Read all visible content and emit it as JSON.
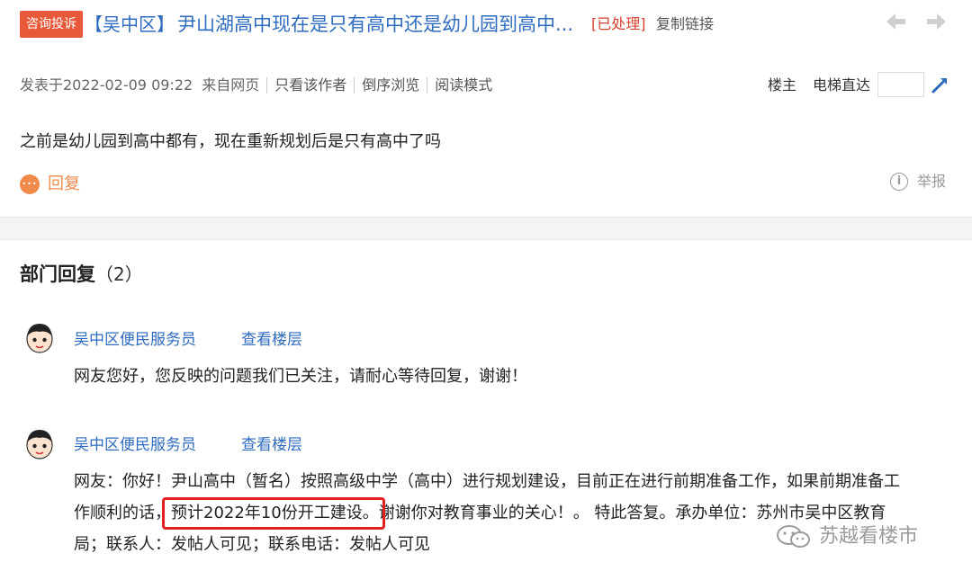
{
  "header": {
    "badge": "咨询投诉",
    "district": "【吴中区】",
    "title": "尹山湖高中现在是只有高中还是幼儿园到高中...",
    "status": "[已处理]",
    "copy_link": "复制链接"
  },
  "meta": {
    "posted": "发表于2022-02-09 09:22",
    "source": "来自网页",
    "only_author": "只看该作者",
    "reverse": "倒序浏览",
    "reading_mode": "阅读模式",
    "louzhu": "楼主",
    "elevator": "电梯直达",
    "floor_value": ""
  },
  "post": {
    "text": "之前是幼儿园到高中都有，现在重新规划后是只有高中了吗",
    "reply_label": "回复",
    "report_label": "举报"
  },
  "replies_section": {
    "title": "部门回复",
    "count": "（2）",
    "items": [
      {
        "author": "吴中区便民服务员",
        "view_floor": "查看楼层",
        "lines": [
          "网友您好，您反映的问题我们已关注，请耐心等待回复，谢谢！"
        ]
      },
      {
        "author": "吴中区便民服务员",
        "view_floor": "查看楼层",
        "lines": [
          "网友：你好！尹山高中（暂名）按照高级中学（高中）进行规划建设，目前正在进行前期准备工作，如果前期准备工",
          "作顺利的话，预计2022年10份开工建设。谢谢你对教育事业的关心！。 特此答复。承办单位：苏州市吴中区教育",
          "局；联系人：发帖人可见；联系电话：发帖人可见"
        ]
      }
    ]
  },
  "watermark": "苏越看楼市",
  "colors": {
    "accent_blue": "#2f6cc0",
    "badge_orange": "#e8593a",
    "status_red": "#d8412f",
    "reply_orange": "#f08a4b",
    "highlight_red": "#e21f1f"
  }
}
